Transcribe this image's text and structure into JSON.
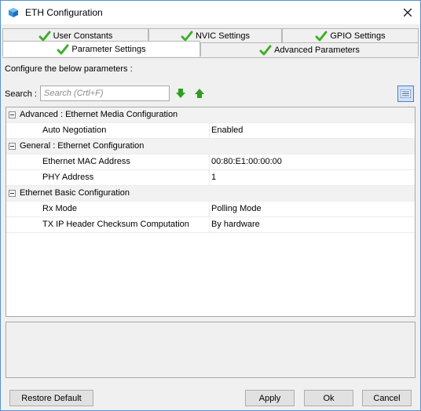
{
  "window": {
    "title": "ETH Configuration",
    "app_icon": "cube-icon",
    "close_icon": "close-icon"
  },
  "tabs": {
    "row1": [
      {
        "label": "User Constants",
        "icon": "check-icon",
        "active": false
      },
      {
        "label": "NVIC Settings",
        "icon": "check-icon",
        "active": false
      },
      {
        "label": "GPIO Settings",
        "icon": "check-icon",
        "active": false
      }
    ],
    "row2": [
      {
        "label": "Parameter Settings",
        "icon": "check-icon",
        "active": true
      },
      {
        "label": "Advanced Parameters",
        "icon": "check-icon",
        "active": false
      }
    ]
  },
  "main": {
    "configure_label": "Configure the below parameters :",
    "search_label": "Search :",
    "search_placeholder": "Search (Crtl+F)",
    "search_value": ""
  },
  "tree": {
    "groups": [
      {
        "label": "Advanced : Ethernet Media Configuration",
        "params": [
          {
            "name": "Auto Negotiation",
            "value": "Enabled"
          }
        ]
      },
      {
        "label": "General : Ethernet Configuration",
        "params": [
          {
            "name": "Ethernet MAC Address",
            "value": "00:80:E1:00:00:00"
          },
          {
            "name": "PHY Address",
            "value": "1"
          }
        ]
      },
      {
        "label": "Ethernet Basic Configuration",
        "params": [
          {
            "name": "Rx Mode",
            "value": "Polling Mode"
          },
          {
            "name": "TX IP Header Checksum Computation",
            "value": "By hardware"
          }
        ]
      }
    ]
  },
  "buttons": {
    "restore_default": "Restore Default",
    "apply": "Apply",
    "ok": "Ok",
    "cancel": "Cancel"
  },
  "colors": {
    "check_green": "#3fae29",
    "arrow_green": "#2f9e1f",
    "accent_blue": "#4a7fc0"
  }
}
